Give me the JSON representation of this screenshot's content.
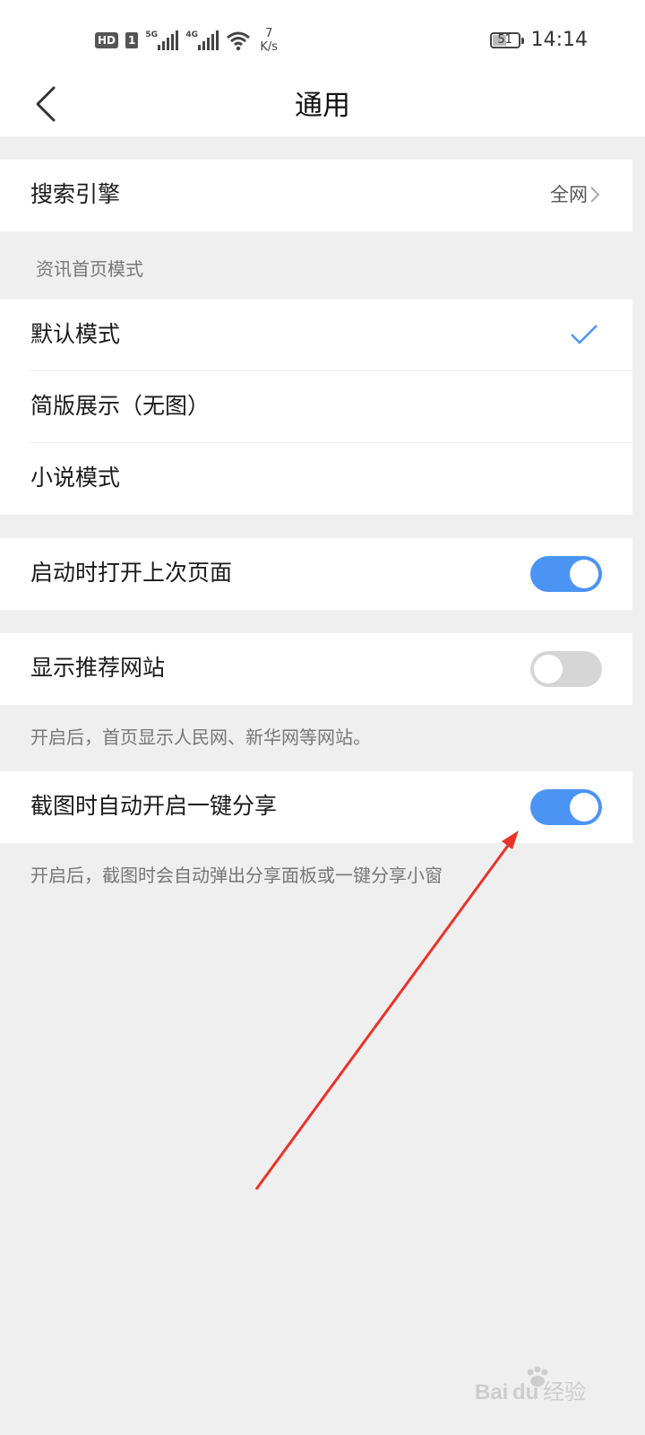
{
  "status_bar": {
    "hd_badge": "HD",
    "sim_badge": "1",
    "signal1_label": "5G",
    "signal2_label": "4G",
    "speed_value": "7",
    "speed_unit": "K/s",
    "battery_level": "51",
    "time": "14:14",
    "icons": [
      "hd-icon",
      "signal-5g-icon",
      "signal-4g-icon",
      "wifi-icon",
      "battery-icon"
    ]
  },
  "nav": {
    "title": "通用",
    "back_icon": "chevron-left-icon"
  },
  "search_engine": {
    "label": "搜索引擎",
    "value": "全网"
  },
  "news_mode": {
    "header": "资讯首页模式",
    "options": [
      {
        "label": "默认模式",
        "selected": true
      },
      {
        "label": "简版展示（无图）",
        "selected": false
      },
      {
        "label": "小说模式",
        "selected": false
      }
    ]
  },
  "settings": {
    "restore_last_page": {
      "label": "启动时打开上次页面",
      "on": true
    },
    "show_recommended": {
      "label": "显示推荐网站",
      "on": false,
      "note": "开启后，首页显示人民网、新华网等网站。"
    },
    "screenshot_share": {
      "label": "截图时自动开启一键分享",
      "on": true,
      "note": "开启后，截图时会自动弹出分享面板或一键分享小窗"
    }
  },
  "colors": {
    "accent": "#4b94f4",
    "annotation_arrow": "#e8332a"
  },
  "watermark": {
    "text": "Baidu经验"
  }
}
